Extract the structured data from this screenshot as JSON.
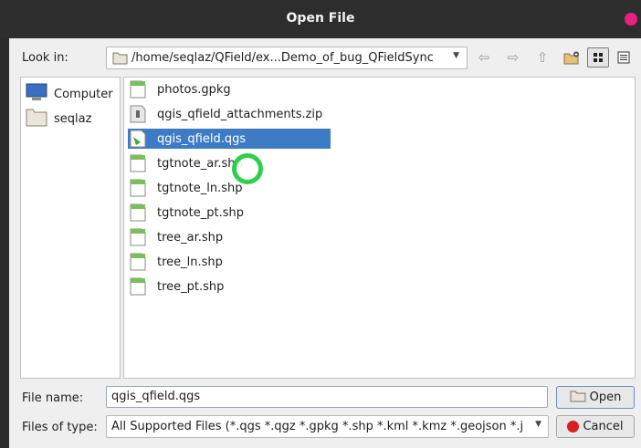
{
  "window": {
    "title": "Open File"
  },
  "toolbar": {
    "look_in_label": "Look in:",
    "path": "/home/seqlaz/QField/ex...Demo_of_bug_QFieldSync",
    "back_icon": "back-arrow-icon",
    "forward_icon": "forward-arrow-icon",
    "up_icon": "up-arrow-icon",
    "new_folder_icon": "new-folder-icon",
    "list_view_icon": "list-view-icon",
    "detail_view_icon": "detail-view-icon"
  },
  "sidebar": {
    "items": [
      {
        "label": "Computer",
        "icon": "computer-icon"
      },
      {
        "label": "seqlaz",
        "icon": "folder-icon"
      }
    ]
  },
  "files": {
    "items": [
      {
        "name": "photos.gpkg",
        "icon": "gpkg-file-icon",
        "selected": false
      },
      {
        "name": "qgis_qfield_attachments.zip",
        "icon": "zip-file-icon",
        "selected": false
      },
      {
        "name": "qgis_qfield.qgs",
        "icon": "qgs-file-icon",
        "selected": true
      },
      {
        "name": "tgtnote_ar.shp",
        "icon": "shp-file-icon",
        "selected": false
      },
      {
        "name": "tgtnote_ln.shp",
        "icon": "shp-file-icon",
        "selected": false
      },
      {
        "name": "tgtnote_pt.shp",
        "icon": "shp-file-icon",
        "selected": false
      },
      {
        "name": "tree_ar.shp",
        "icon": "shp-file-icon",
        "selected": false
      },
      {
        "name": "tree_ln.shp",
        "icon": "shp-file-icon",
        "selected": false
      },
      {
        "name": "tree_pt.shp",
        "icon": "shp-file-icon",
        "selected": false
      }
    ]
  },
  "footer": {
    "file_name_label": "File name:",
    "file_name_value": "qgis_qfield.qgs",
    "file_type_label": "Files of type:",
    "file_type_value": "All Supported Files (*.qgs *.qgz *.gpkg *.shp *.kml *.kmz *.geojson *.j",
    "open_label": "Open",
    "cancel_label": "Cancel"
  },
  "colors": {
    "selection": "#3d7cc4",
    "cursor_ring": "#2fcf4d",
    "title_bar": "#2d2d2d",
    "close_dot": "#e8207f"
  }
}
